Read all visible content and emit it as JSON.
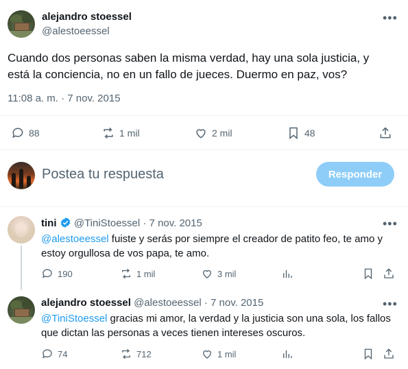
{
  "main_tweet": {
    "author_name": "alejandro stoessel",
    "author_handle": "@alestoeessel",
    "text": "Cuando dos personas saben la misma verdad, hay una sola justicia, y está la conciencia, no en un fallo de jueces. Duermo en paz, vos?",
    "timestamp": "11:08 a. m. · 7 nov. 2015",
    "replies": "88",
    "reposts": "1 mil",
    "likes": "2 mil",
    "bookmarks": "48"
  },
  "composer": {
    "placeholder": "Postea tu respuesta",
    "button_label": "Responder"
  },
  "replies": [
    {
      "author_name": "tini",
      "author_handle": "@TiniStoessel",
      "date": "· 7 nov. 2015",
      "mention": "@alestoeessel",
      "text": " fuiste y serás por siempre el creador de patito feo, te amo y estoy orgullosa de vos papa, te amo.",
      "replies": "190",
      "reposts": "1 mil",
      "likes": "3 mil"
    },
    {
      "author_name": "alejandro stoessel",
      "author_handle": "@alestoeessel",
      "date": "· 7 nov. 2015",
      "mention": "@TiniStoessel",
      "text": " gracias mi amor, la verdad y la justicia son una sola, los fallos que dictan las personas a veces tienen intereses oscuros.",
      "replies": "74",
      "reposts": "712",
      "likes": "1 mil"
    }
  ],
  "colors": {
    "accent": "#1d9bf0",
    "muted": "#536471",
    "button_disabled": "#8ecdf8"
  }
}
